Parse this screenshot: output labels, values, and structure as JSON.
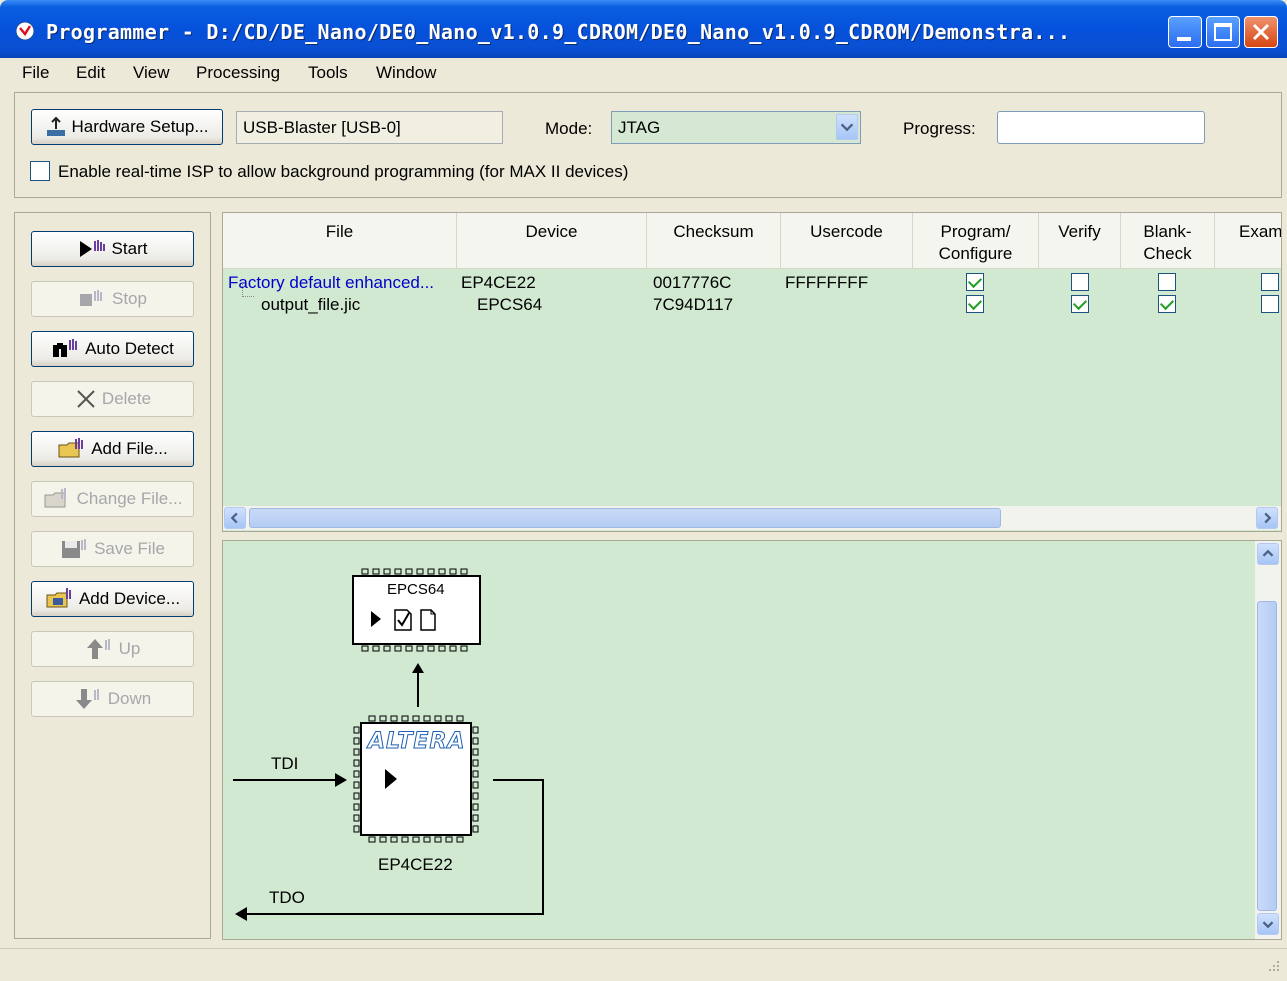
{
  "window": {
    "title": "Programmer - D:/CD/DE_Nano/DE0_Nano_v1.0.9_CDROM/DE0_Nano_v1.0.9_CDROM/Demonstra...",
    "controls": [
      "minimize",
      "maximize",
      "close"
    ]
  },
  "menu": [
    "File",
    "Edit",
    "View",
    "Processing",
    "Tools",
    "Window"
  ],
  "toolbar": {
    "hardware_setup_label": "Hardware Setup...",
    "hardware_value": "USB-Blaster [USB-0]",
    "mode_label": "Mode:",
    "mode_value": "JTAG",
    "progress_label": "Progress:",
    "isp_label": "Enable real-time ISP to allow background programming (for MAX II devices)"
  },
  "left_buttons": [
    {
      "label": "Start",
      "enabled": true,
      "icon": "start-icon"
    },
    {
      "label": "Stop",
      "enabled": false,
      "icon": "stop-icon"
    },
    {
      "label": "Auto Detect",
      "enabled": true,
      "icon": "auto-detect-icon"
    },
    {
      "label": "Delete",
      "enabled": false,
      "icon": "delete-icon"
    },
    {
      "label": "Add File...",
      "enabled": true,
      "icon": "add-file-icon"
    },
    {
      "label": "Change File...",
      "enabled": false,
      "icon": "change-file-icon"
    },
    {
      "label": "Save File",
      "enabled": false,
      "icon": "save-file-icon"
    },
    {
      "label": "Add Device...",
      "enabled": true,
      "icon": "add-device-icon"
    },
    {
      "label": "Up",
      "enabled": false,
      "icon": "up-icon"
    },
    {
      "label": "Down",
      "enabled": false,
      "icon": "down-icon"
    }
  ],
  "table": {
    "columns": [
      "File",
      "Device",
      "Checksum",
      "Usercode",
      "Program/ Configure",
      "Verify",
      "Blank- Check",
      "Exam"
    ],
    "rows": [
      {
        "file": "Factory default enhanced...",
        "device": "EP4CE22",
        "checksum": "0017776C",
        "usercode": "FFFFFFFF",
        "program": true,
        "verify": false,
        "blank": false
      },
      {
        "file": "output_file.jic",
        "device": "EPCS64",
        "checksum": "7C94D117",
        "usercode": "",
        "program": true,
        "verify": true,
        "blank": true
      }
    ]
  },
  "diagram": {
    "flash_label": "EPCS64",
    "fpga_label": "EP4CE22",
    "logo_text": "ALTERA",
    "tdi_label": "TDI",
    "tdo_label": "TDO"
  },
  "colors": {
    "title_bar": "#0551dc",
    "panel_green": "#d1e8d1",
    "link_blue": "#0000cc",
    "check_green": "#21a121"
  }
}
